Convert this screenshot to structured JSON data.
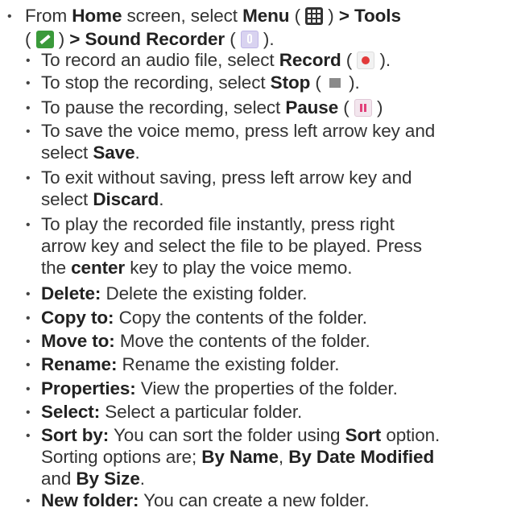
{
  "bullet": "•",
  "item1": {
    "t1": "From ",
    "b1": "Home",
    "t2": " screen, select ",
    "b2": "Menu",
    "t3": " ( ",
    "t4": " ) ",
    "b3": "> Tools",
    "t5": "( ",
    "t6": " ) ",
    "b4": "> Sound Recorder",
    "t7": " ( ",
    "t8": " )."
  },
  "sub": {
    "record": {
      "t1": "To record an audio file, select ",
      "b1": "Record",
      "t2": " ( ",
      "t3": " )."
    },
    "stop": {
      "t1": "To stop the recording, select ",
      "b1": "Stop",
      "t2": " ( ",
      "t3": " )."
    },
    "pause": {
      "t1": "To pause the recording, select ",
      "b1": "Pause",
      "t2": " ( ",
      "t3": " )"
    },
    "save": {
      "t1": "To save the voice memo, press left arrow key and",
      "t2": "select ",
      "b1": "Save",
      "t3": "."
    },
    "discard": {
      "t1": "To exit without saving, press left arrow key and",
      "t2": "select ",
      "b1": "Discard",
      "t3": "."
    },
    "play": {
      "l1": "To play the recorded file instantly, press right",
      "l2": "arrow key and select the file to be played. Press",
      "t1": "the ",
      "b1": "center",
      "t2": " key to play the voice memo."
    },
    "delete": {
      "b1": "Delete:",
      "t1": " Delete the existing folder."
    },
    "copy": {
      "b1": "Copy to:",
      "t1": " Copy the contents of the folder."
    },
    "move": {
      "b1": "Move to:",
      "t1": " Move the contents of the folder."
    },
    "rename": {
      "b1": "Rename:",
      "t1": " Rename the existing folder."
    },
    "props": {
      "b1": "Properties:",
      "t1": " View the properties of the folder."
    },
    "select": {
      "b1": "Select:",
      "t1": " Select a particular folder."
    },
    "sort": {
      "b1": "Sort by:",
      "t1": " You can sort the folder using ",
      "b2": "Sort",
      "t2": " option.",
      "l2a": "Sorting options are; ",
      "b3": "By Name",
      "t3": ", ",
      "b4": "By Date Modified",
      "l3a": "and ",
      "b5": "By Size",
      "t4": "."
    },
    "newfolder": {
      "b1": "New folder:",
      "t1": " You can create a new folder."
    }
  },
  "icons": {
    "menu": "menu-grid-icon",
    "tools": "tools-icon",
    "recorder": "sound-recorder-icon",
    "record": "record-icon",
    "stop": "stop-icon",
    "pause": "pause-icon"
  }
}
